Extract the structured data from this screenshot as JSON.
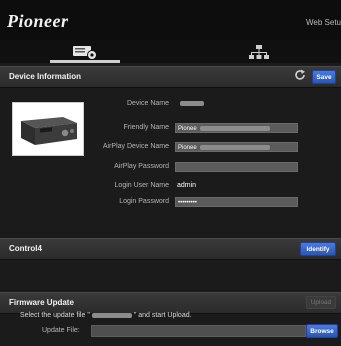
{
  "header": {
    "brand": "Pioneer",
    "web_setup": "Web Setu"
  },
  "nav": {
    "tabs": [
      {
        "icon": "device-settings-icon"
      },
      {
        "icon": "network-icon"
      }
    ]
  },
  "device_info": {
    "title": "Device Information",
    "save_label": "Save",
    "fields": [
      {
        "label": "Device Name",
        "value": ""
      },
      {
        "label": "Friendly Name",
        "value": "Pionee"
      },
      {
        "label": "AirPlay Device Name",
        "value": "Pionee"
      },
      {
        "label": "AirPlay Password",
        "value": ""
      },
      {
        "label": "Login User Name",
        "value": "admin"
      },
      {
        "label": "Login Password",
        "value": "•••••••••"
      }
    ]
  },
  "control4": {
    "title": "Control4",
    "identify_label": "Identify"
  },
  "firmware": {
    "title": "Firmware Update",
    "upload_label": "Upload",
    "instruction_prefix": "Select the update file \"",
    "instruction_suffix": "\" and start Upload.",
    "update_file_label": "Update File:",
    "browse_label": "Browse"
  }
}
